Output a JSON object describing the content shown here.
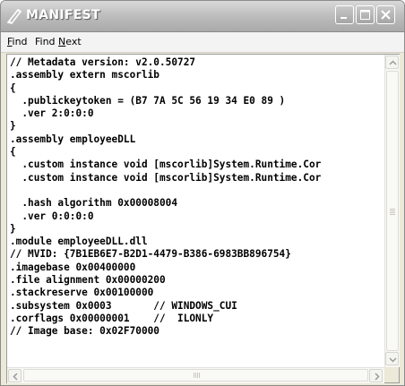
{
  "window": {
    "title": "MANIFEST",
    "controls": {
      "minimize": "minimize-icon",
      "maximize": "maximize-icon",
      "close": "close-icon"
    }
  },
  "menu": {
    "find": {
      "mnemonic": "F",
      "rest": "ind"
    },
    "find_next": {
      "before": "Find ",
      "mnemonic": "N",
      "rest": "ext"
    }
  },
  "code_lines": [
    "// Metadata version: v2.0.50727",
    ".assembly extern mscorlib",
    "{",
    "  .publickeytoken = (B7 7A 5C 56 19 34 E0 89 )",
    "  .ver 2:0:0:0",
    "}",
    ".assembly employeeDLL",
    "{",
    "  .custom instance void [mscorlib]System.Runtime.Cor",
    "  .custom instance void [mscorlib]System.Runtime.Cor",
    "",
    "  .hash algorithm 0x00008004",
    "  .ver 0:0:0:0",
    "}",
    ".module employeeDLL.dll",
    "// MVID: {7B1EB6E7-B2D1-4479-B386-6983BB896754}",
    ".imagebase 0x00400000",
    ".file alignment 0x00000200",
    ".stackreserve 0x00100000",
    ".subsystem 0x0003       // WINDOWS_CUI",
    ".corflags 0x00000001    //  ILONLY",
    "// Image base: 0x02F70000"
  ],
  "colors": {
    "title_text": "#ffffff",
    "titlebar": "#bfbfbf",
    "editor_bg": "#ffffff",
    "menu_bg": "#f3f3f3"
  }
}
